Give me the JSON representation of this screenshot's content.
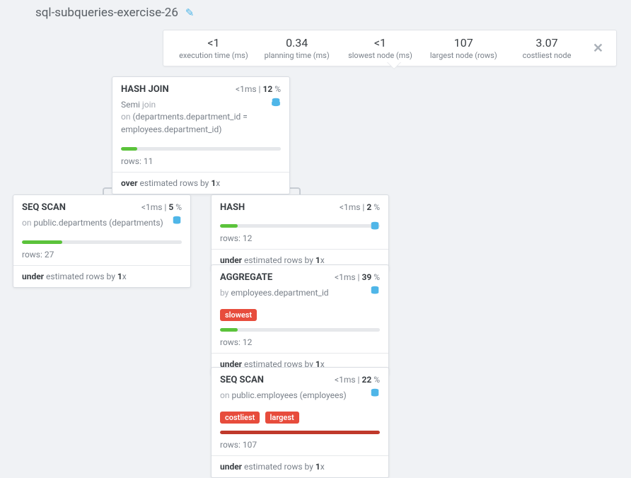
{
  "title": "sql-subqueries-exercise-26",
  "stats": {
    "exec_time": {
      "value": "<1",
      "label": "execution time (ms)"
    },
    "plan_time": {
      "value": "0.34",
      "label": "planning time (ms)"
    },
    "slowest": {
      "value": "<1",
      "label": "slowest node (ms)"
    },
    "largest": {
      "value": "107",
      "label": "largest node (rows)"
    },
    "costliest": {
      "value": "3.07",
      "label": "costliest node"
    }
  },
  "nodes": {
    "hashjoin": {
      "title": "HASH JOIN",
      "time": "<1ms",
      "pct": "12",
      "desc_prefix": "Semi ",
      "desc_grey1": "join",
      "desc_line2a": "on ",
      "desc_line2b": "(departments.department_id = employees.department_id)",
      "rows": "rows: 11",
      "footer_b": "over",
      "footer_mid": " estimated rows by ",
      "footer_x": "1",
      "footer_suffix": "x",
      "bar_pct": 10,
      "bar_color": "#5bc33b"
    },
    "seqscan1": {
      "title": "SEQ SCAN",
      "time": "<1ms",
      "pct": "5",
      "desc_a": "on ",
      "desc_b": "public.departments (departments)",
      "rows": "rows: 27",
      "footer_b": "under",
      "footer_mid": " estimated rows by ",
      "footer_x": "1",
      "footer_suffix": "x",
      "bar_pct": 25,
      "bar_color": "#5bc33b"
    },
    "hash": {
      "title": "HASH",
      "time": "<1ms",
      "pct": "2",
      "rows": "rows: 12",
      "footer_b": "under",
      "footer_mid": " estimated rows by ",
      "footer_x": "1",
      "footer_suffix": "x",
      "bar_pct": 11,
      "bar_color": "#5bc33b"
    },
    "aggregate": {
      "title": "AGGREGATE",
      "time": "<1ms",
      "pct": "39",
      "desc_a": "by ",
      "desc_b": "employees.department_id",
      "badge1": "slowest",
      "rows": "rows: 12",
      "footer_b": "under",
      "footer_mid": " estimated rows by ",
      "footer_x": "1",
      "footer_suffix": "x",
      "bar_pct": 11,
      "bar_color": "#5bc33b"
    },
    "seqscan2": {
      "title": "SEQ SCAN",
      "time": "<1ms",
      "pct": "22",
      "desc_a": "on ",
      "desc_b": "public.employees (employees)",
      "badge1": "costliest",
      "badge2": "largest",
      "rows": "rows: 107",
      "footer_b": "under",
      "footer_mid": " estimated rows by ",
      "footer_x": "1",
      "footer_suffix": "x",
      "bar_pct": 100,
      "bar_color": "#c0392b"
    }
  }
}
